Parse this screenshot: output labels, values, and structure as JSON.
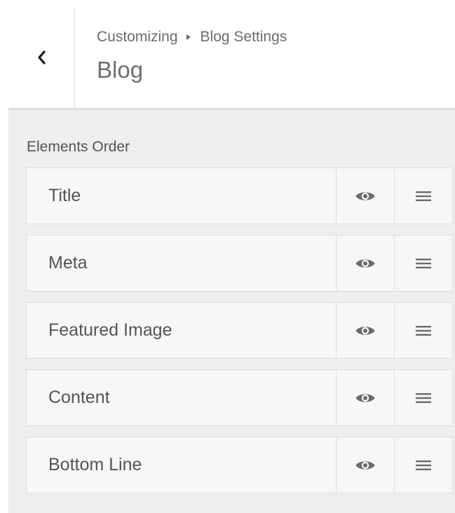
{
  "header": {
    "breadcrumb_parent": "Customizing",
    "breadcrumb_current": "Blog Settings",
    "title": "Blog"
  },
  "section": {
    "label": "Elements Order"
  },
  "items": [
    {
      "label": "Title",
      "visible": true
    },
    {
      "label": "Meta",
      "visible": true
    },
    {
      "label": "Featured Image",
      "visible": true
    },
    {
      "label": "Content",
      "visible": true
    },
    {
      "label": "Bottom Line",
      "visible": true
    }
  ],
  "icons": {
    "back": "chevron-left-icon",
    "visibility": "eye-icon",
    "drag": "drag-handle-icon"
  },
  "colors": {
    "panel_bg": "#eeeeee",
    "item_bg": "#f7f7f7",
    "icon": "#6b6b6b",
    "text": "#555555"
  }
}
